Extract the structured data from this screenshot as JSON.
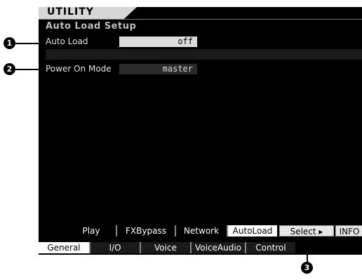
{
  "title": "UTILITY",
  "heading": "Auto Load Setup",
  "params": {
    "auto_load": {
      "label": "Auto Load",
      "value": "off"
    },
    "power_on_mode": {
      "label": "Power On Mode",
      "value": "master"
    }
  },
  "upper_tabs": [
    "Play",
    "FXBypass",
    "Network",
    "AutoLoad",
    "Select ▸",
    "INFO"
  ],
  "lower_tabs": [
    "General",
    "I/O",
    "Voice",
    "VoiceAudio",
    "Control"
  ],
  "callouts": [
    "1",
    "2",
    "3"
  ],
  "colors": {
    "screen_bg": "#000000",
    "selected_bg": "#dcdcdc"
  }
}
